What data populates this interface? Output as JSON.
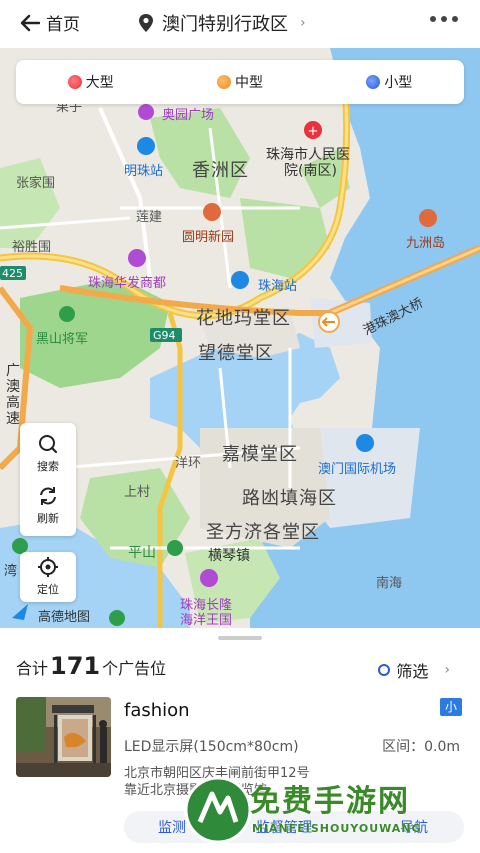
{
  "header": {
    "back_label": "首页",
    "location": "澳门特别行政区"
  },
  "legend": {
    "items": [
      {
        "label": "大型",
        "color": "#e8323c"
      },
      {
        "label": "中型",
        "color": "#f08a1c"
      },
      {
        "label": "小型",
        "color": "#2a5bd7"
      }
    ]
  },
  "map": {
    "labels": {
      "xiangzhou": "香洲区",
      "zhuhai_hospital_1": "珠海市人民医",
      "zhuhai_hospital_2": "院(南区)",
      "mingzhu": "明珠站",
      "aoyuan": "奥园广场",
      "zhangjiawei": "张家围",
      "lianjian": "莲建",
      "yuanming": "圆明新园",
      "jiuzhou": "九洲岛",
      "yushengwei": "裕胜围",
      "huafa": "珠海华发商都",
      "zhuhai_station": "珠海站",
      "bridge": "港珠澳大桥",
      "heishanjiangjun": "黑山将军",
      "huadima": "花地玛堂区",
      "wangde": "望德堂区",
      "jiamo": "嘉模堂区",
      "airport": "澳门国际机场",
      "luhuan": "路凼填海区",
      "shengfangji": "圣方济各堂区",
      "yanghuan": "洋环",
      "shangcun": "上村",
      "pingshan": "平山",
      "hengqin": "横琴镇",
      "changlong_1": "珠海长隆",
      "changlong_2": "海洋王国",
      "nanhai": "南海",
      "gaode": "高德地图",
      "road_425": "425",
      "road_g94": "G94",
      "guangao_1": "广",
      "guangao_2": "澳",
      "guangao_3": "高",
      "guangao_4": "速",
      "wan": "湾",
      "chezi": "果子",
      "road_g94b": "G94"
    }
  },
  "tools": {
    "search": "搜索",
    "refresh": "刷新",
    "locate": "定位"
  },
  "sheet": {
    "total_prefix": "合计",
    "total_count": "171",
    "total_suffix": "个广告位",
    "filter_label": "筛选"
  },
  "card": {
    "title": "fashion",
    "size_badge": "小",
    "spec": "LED显示屏(150cm*80cm)",
    "interval": "区间：0.0m",
    "address_line1": "北京市朝阳区庆丰闸前街甲12号",
    "address_line2": "靠近北京摄影艺术展览馆",
    "actions": {
      "monitor": "监测",
      "manage": "监督管理",
      "navigate": "导航"
    }
  },
  "watermark": {
    "title": "免费手游网",
    "subtitle": "MIANFEISHOUYOUWANG"
  }
}
